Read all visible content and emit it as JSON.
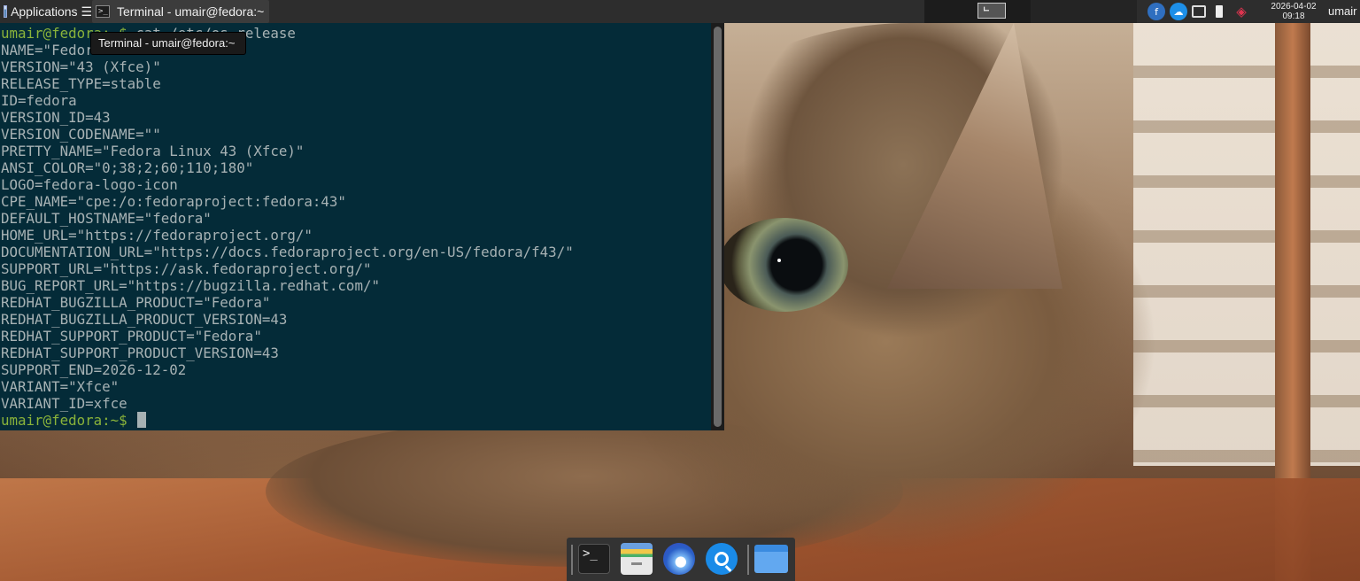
{
  "top_panel": {
    "applications_label": "Applications ☰",
    "task_title": "Terminal - umair@fedora:~",
    "clock_date": "2026-04-02",
    "clock_time": "09:18",
    "user": "umair"
  },
  "tooltip": {
    "text": "Terminal - umair@fedora:~"
  },
  "terminal": {
    "prompt": "umair@fedora:~$",
    "command": "cat /etc/os-release",
    "output": [
      "NAME=\"Fedora Linux\"",
      "VERSION=\"43 (Xfce)\"",
      "RELEASE_TYPE=stable",
      "ID=fedora",
      "VERSION_ID=43",
      "VERSION_CODENAME=\"\"",
      "PRETTY_NAME=\"Fedora Linux 43 (Xfce)\"",
      "ANSI_COLOR=\"0;38;2;60;110;180\"",
      "LOGO=fedora-logo-icon",
      "CPE_NAME=\"cpe:/o:fedoraproject:fedora:43\"",
      "DEFAULT_HOSTNAME=\"fedora\"",
      "HOME_URL=\"https://fedoraproject.org/\"",
      "DOCUMENTATION_URL=\"https://docs.fedoraproject.org/en-US/fedora/f43/\"",
      "SUPPORT_URL=\"https://ask.fedoraproject.org/\"",
      "BUG_REPORT_URL=\"https://bugzilla.redhat.com/\"",
      "REDHAT_BUGZILLA_PRODUCT=\"Fedora\"",
      "REDHAT_BUGZILLA_PRODUCT_VERSION=43",
      "REDHAT_SUPPORT_PRODUCT=\"Fedora\"",
      "REDHAT_SUPPORT_PRODUCT_VERSION=43",
      "SUPPORT_END=2026-12-02",
      "VARIANT=\"Xfce\"",
      "VARIANT_ID=xfce"
    ]
  },
  "dock": {
    "terminal_glyph": ">_"
  },
  "colors": {
    "terminal_bg": "#042b38",
    "prompt": "#8ab33a",
    "text": "#a7b2b4",
    "panel": "#2d2d2d"
  }
}
